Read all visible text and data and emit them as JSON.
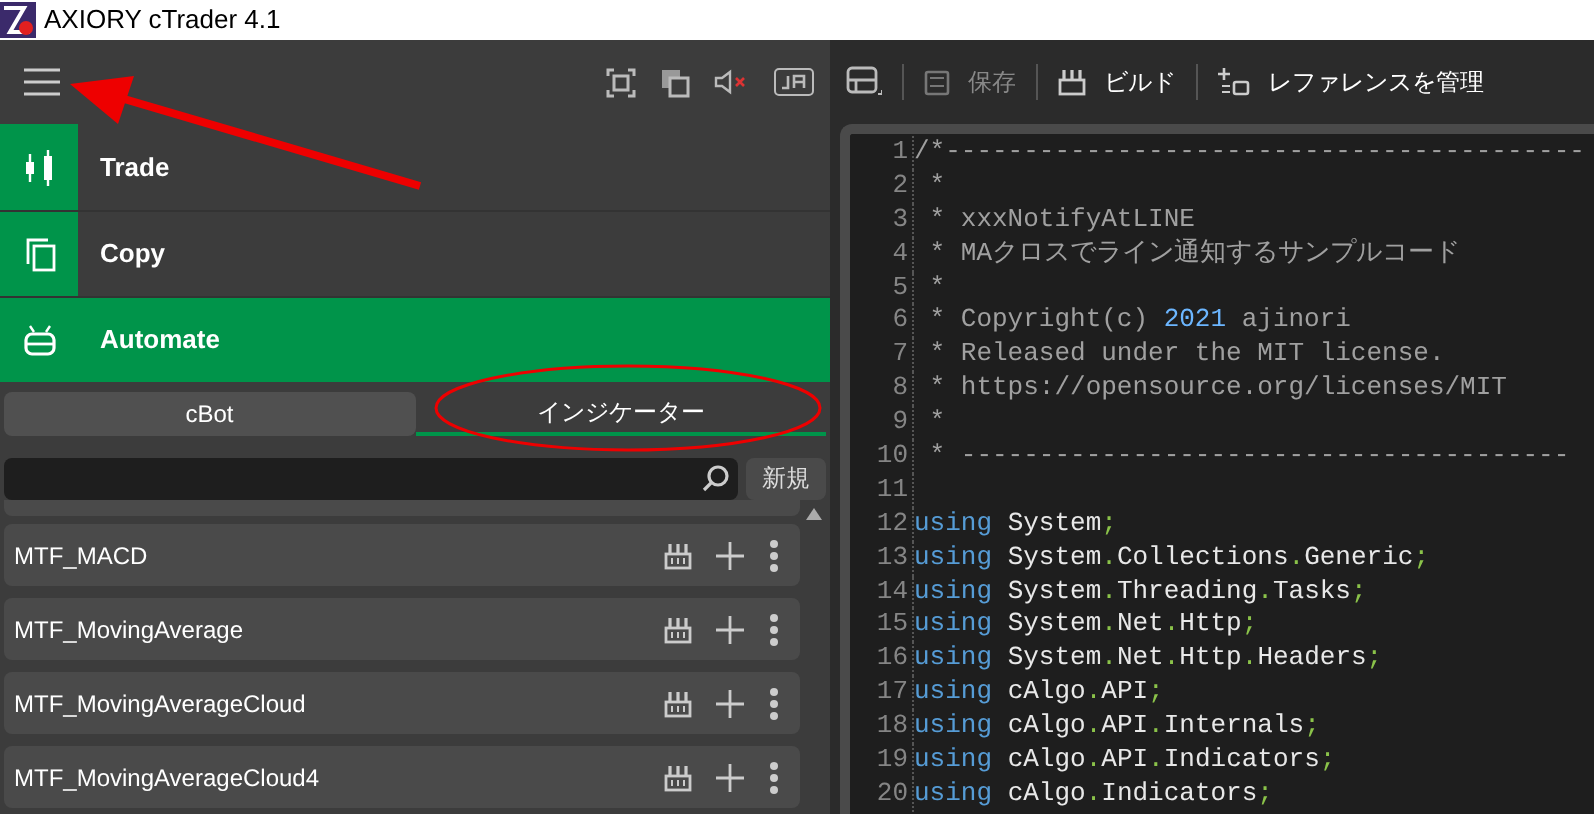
{
  "window": {
    "title": "AXIORY cTrader 4.1"
  },
  "nav": [
    {
      "label": "Trade",
      "kind": "candles",
      "selected": false
    },
    {
      "label": "Copy",
      "kind": "copy",
      "selected": false
    },
    {
      "label": "Automate",
      "kind": "robot",
      "selected": true
    }
  ],
  "tabs": [
    {
      "label": "cBot",
      "selected": false
    },
    {
      "label": "インジケーター",
      "selected": true
    }
  ],
  "search": {
    "new_button": "新規"
  },
  "items": [
    {
      "name": "MTF_MACD"
    },
    {
      "name": "MTF_MovingAverage"
    },
    {
      "name": "MTF_MovingAverageCloud"
    },
    {
      "name": "MTF_MovingAverageCloud4"
    }
  ],
  "toolbar": [
    {
      "label": "保存",
      "kind": "save",
      "disabled": true
    },
    {
      "label": "ビルド",
      "kind": "build",
      "disabled": false
    },
    {
      "label": "レファレンスを管理",
      "kind": "refs",
      "disabled": false
    }
  ],
  "code": [
    {
      "n": "1",
      "tokens": [
        {
          "kind": "comment",
          "text": "/*-----------------------------------------"
        }
      ]
    },
    {
      "n": "2",
      "tokens": [
        {
          "kind": "comment",
          "text": " *"
        }
      ]
    },
    {
      "n": "3",
      "tokens": [
        {
          "kind": "comment",
          "text": " * xxxNotifyAtLINE"
        }
      ]
    },
    {
      "n": "4",
      "tokens": [
        {
          "kind": "comment",
          "text": " * MAクロスでライン通知するサンプルコード"
        }
      ]
    },
    {
      "n": "5",
      "tokens": [
        {
          "kind": "comment",
          "text": " *"
        }
      ]
    },
    {
      "n": "6",
      "tokens": [
        {
          "kind": "comment",
          "text": " * Copyright(c) "
        },
        {
          "kind": "number",
          "text": "2021"
        },
        {
          "kind": "comment",
          "text": " ajinori"
        }
      ]
    },
    {
      "n": "7",
      "tokens": [
        {
          "kind": "comment",
          "text": " * Released under the MIT license."
        }
      ]
    },
    {
      "n": "8",
      "tokens": [
        {
          "kind": "comment",
          "text": " * https://opensource.org/licenses/MIT"
        }
      ]
    },
    {
      "n": "9",
      "tokens": [
        {
          "kind": "comment",
          "text": " *"
        }
      ]
    },
    {
      "n": "10",
      "tokens": [
        {
          "kind": "comment",
          "text": " * ---------------------------------------"
        }
      ]
    },
    {
      "n": "11"
    },
    {
      "n": "12",
      "tokens": [
        {
          "kind": "keyword",
          "text": "using"
        },
        {
          "kind": "ident",
          "text": " System"
        },
        {
          "kind": "punct",
          "text": ";"
        }
      ]
    },
    {
      "n": "13",
      "tokens": [
        {
          "kind": "keyword",
          "text": "using"
        },
        {
          "kind": "ident",
          "text": " System"
        },
        {
          "kind": "punct",
          "text": "."
        },
        {
          "kind": "ident",
          "text": "Collections"
        },
        {
          "kind": "punct",
          "text": "."
        },
        {
          "kind": "ident",
          "text": "Generic"
        },
        {
          "kind": "punct",
          "text": ";"
        }
      ]
    },
    {
      "n": "14",
      "tokens": [
        {
          "kind": "keyword",
          "text": "using"
        },
        {
          "kind": "ident",
          "text": " System"
        },
        {
          "kind": "punct",
          "text": "."
        },
        {
          "kind": "ident",
          "text": "Threading"
        },
        {
          "kind": "punct",
          "text": "."
        },
        {
          "kind": "ident",
          "text": "Tasks"
        },
        {
          "kind": "punct",
          "text": ";"
        }
      ]
    },
    {
      "n": "15",
      "tokens": [
        {
          "kind": "keyword",
          "text": "using"
        },
        {
          "kind": "ident",
          "text": " System"
        },
        {
          "kind": "punct",
          "text": "."
        },
        {
          "kind": "ident",
          "text": "Net"
        },
        {
          "kind": "punct",
          "text": "."
        },
        {
          "kind": "ident",
          "text": "Http"
        },
        {
          "kind": "punct",
          "text": ";"
        }
      ]
    },
    {
      "n": "16",
      "tokens": [
        {
          "kind": "keyword",
          "text": "using"
        },
        {
          "kind": "ident",
          "text": " System"
        },
        {
          "kind": "punct",
          "text": "."
        },
        {
          "kind": "ident",
          "text": "Net"
        },
        {
          "kind": "punct",
          "text": "."
        },
        {
          "kind": "ident",
          "text": "Http"
        },
        {
          "kind": "punct",
          "text": "."
        },
        {
          "kind": "ident",
          "text": "Headers"
        },
        {
          "kind": "punct",
          "text": ";"
        }
      ]
    },
    {
      "n": "17",
      "tokens": [
        {
          "kind": "keyword",
          "text": "using"
        },
        {
          "kind": "ident",
          "text": " cAlgo"
        },
        {
          "kind": "punct",
          "text": "."
        },
        {
          "kind": "ident",
          "text": "API"
        },
        {
          "kind": "punct",
          "text": ";"
        }
      ]
    },
    {
      "n": "18",
      "tokens": [
        {
          "kind": "keyword",
          "text": "using"
        },
        {
          "kind": "ident",
          "text": " cAlgo"
        },
        {
          "kind": "punct",
          "text": "."
        },
        {
          "kind": "ident",
          "text": "API"
        },
        {
          "kind": "punct",
          "text": "."
        },
        {
          "kind": "ident",
          "text": "Internals"
        },
        {
          "kind": "punct",
          "text": ";"
        }
      ]
    },
    {
      "n": "19",
      "tokens": [
        {
          "kind": "keyword",
          "text": "using"
        },
        {
          "kind": "ident",
          "text": " cAlgo"
        },
        {
          "kind": "punct",
          "text": "."
        },
        {
          "kind": "ident",
          "text": "API"
        },
        {
          "kind": "punct",
          "text": "."
        },
        {
          "kind": "ident",
          "text": "Indicators"
        },
        {
          "kind": "punct",
          "text": ";"
        }
      ]
    },
    {
      "n": "20",
      "tokens": [
        {
          "kind": "keyword",
          "text": "using"
        },
        {
          "kind": "ident",
          "text": " cAlgo"
        },
        {
          "kind": "punct",
          "text": "."
        },
        {
          "kind": "ident",
          "text": "Indicators"
        },
        {
          "kind": "punct",
          "text": ";"
        }
      ]
    }
  ]
}
